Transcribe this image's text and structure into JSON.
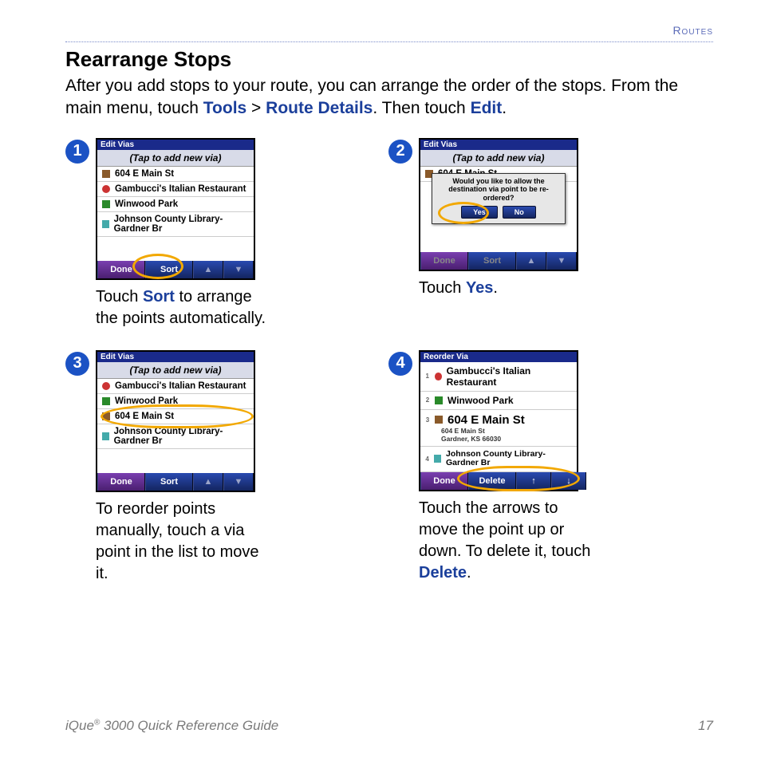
{
  "header": {
    "section": "Routes"
  },
  "title": "Rearrange Stops",
  "intro": {
    "text1": "After you add stops to your route, you can arrange the order of the stops. From the main menu, touch ",
    "kw1": "Tools",
    "sep1": " > ",
    "kw2": "Route Details",
    "text2": ". Then touch ",
    "kw3": "Edit",
    "text3": "."
  },
  "steps": {
    "s1": {
      "num": "1",
      "titlebar": "Edit Vias",
      "tap": "(Tap to add new via)",
      "rows": [
        "604 E Main St",
        "Gambucci's Italian Restaurant",
        "Winwood Park",
        "Johnson County Library-Gardner Br"
      ],
      "done": "Done",
      "sort": "Sort",
      "cap_a": "Touch ",
      "cap_kw": "Sort",
      "cap_b": " to arrange the points automatically."
    },
    "s2": {
      "num": "2",
      "titlebar": "Edit Vias",
      "tap": "(Tap to add new via)",
      "row": "604 E Main St",
      "dialog_msg": "Would you like to allow the destination via point to be re-ordered?",
      "yes": "Yes",
      "no": "No",
      "done": "Done",
      "sort": "Sort",
      "cap_a": "Touch ",
      "cap_kw": "Yes",
      "cap_b": "."
    },
    "s3": {
      "num": "3",
      "titlebar": "Edit Vias",
      "tap": "(Tap to add new via)",
      "rows": [
        "Gambucci's Italian Restaurant",
        "Winwood Park",
        "604 E Main St",
        "Johnson County Library-Gardner Br"
      ],
      "done": "Done",
      "sort": "Sort",
      "cap": "To reorder points manually, touch a via point in the list to move it."
    },
    "s4": {
      "num": "4",
      "titlebar": "Reorder Via",
      "rows": [
        {
          "n": "1",
          "t": "Gambucci's Italian Restaurant"
        },
        {
          "n": "2",
          "t": "Winwood Park"
        },
        {
          "n": "3",
          "t": "604 E Main St",
          "sub1": "604 E Main St",
          "sub2": "Gardner, KS 66030"
        },
        {
          "n": "4",
          "t": "Johnson County Library-Gardner Br"
        }
      ],
      "done": "Done",
      "delete": "Delete",
      "up": "↑",
      "down": "↓",
      "cap_a": "Touch the arrows to move the point up or down. To delete it, touch ",
      "cap_kw": "Delete",
      "cap_b": "."
    }
  },
  "footer": {
    "product": "iQue",
    "reg": "®",
    "guide": " 3000 Quick Reference Guide",
    "page": "17"
  }
}
